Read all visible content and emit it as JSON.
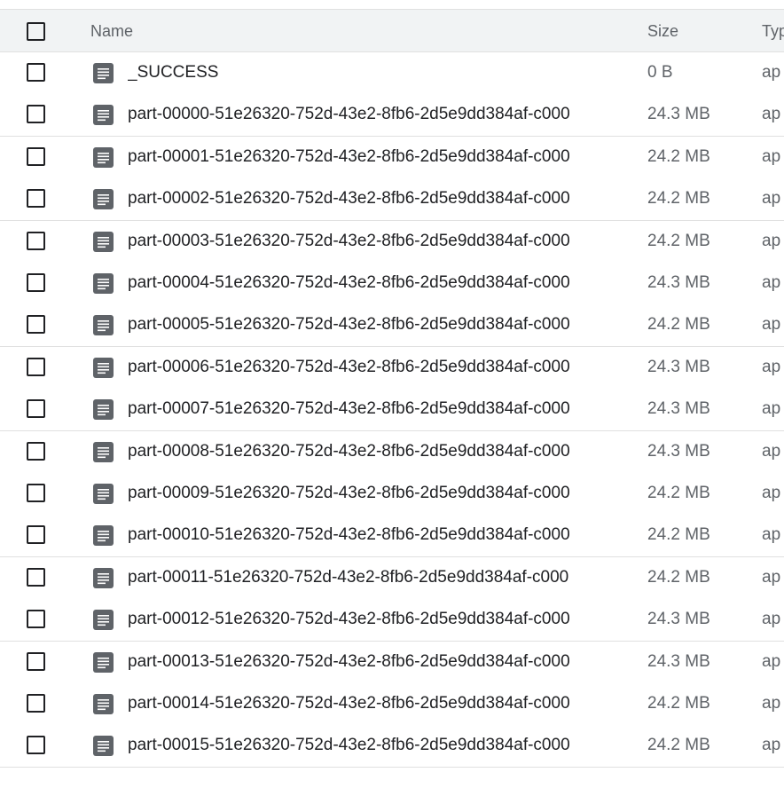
{
  "table": {
    "headers": {
      "name": "Name",
      "size": "Size",
      "type": "Typ"
    },
    "rows": [
      {
        "name": "_SUCCESS",
        "size": "0 B",
        "type": "ap"
      },
      {
        "name": "part-00000-51e26320-752d-43e2-8fb6-2d5e9dd384af-c000",
        "size": "24.3 MB",
        "type": "ap"
      },
      {
        "name": "part-00001-51e26320-752d-43e2-8fb6-2d5e9dd384af-c000",
        "size": "24.2 MB",
        "type": "ap"
      },
      {
        "name": "part-00002-51e26320-752d-43e2-8fb6-2d5e9dd384af-c000",
        "size": "24.2 MB",
        "type": "ap"
      },
      {
        "name": "part-00003-51e26320-752d-43e2-8fb6-2d5e9dd384af-c000",
        "size": "24.2 MB",
        "type": "ap"
      },
      {
        "name": "part-00004-51e26320-752d-43e2-8fb6-2d5e9dd384af-c000",
        "size": "24.3 MB",
        "type": "ap"
      },
      {
        "name": "part-00005-51e26320-752d-43e2-8fb6-2d5e9dd384af-c000",
        "size": "24.2 MB",
        "type": "ap"
      },
      {
        "name": "part-00006-51e26320-752d-43e2-8fb6-2d5e9dd384af-c000",
        "size": "24.3 MB",
        "type": "ap"
      },
      {
        "name": "part-00007-51e26320-752d-43e2-8fb6-2d5e9dd384af-c000",
        "size": "24.3 MB",
        "type": "ap"
      },
      {
        "name": "part-00008-51e26320-752d-43e2-8fb6-2d5e9dd384af-c000",
        "size": "24.3 MB",
        "type": "ap"
      },
      {
        "name": "part-00009-51e26320-752d-43e2-8fb6-2d5e9dd384af-c000",
        "size": "24.2 MB",
        "type": "ap"
      },
      {
        "name": "part-00010-51e26320-752d-43e2-8fb6-2d5e9dd384af-c000",
        "size": "24.2 MB",
        "type": "ap"
      },
      {
        "name": "part-00011-51e26320-752d-43e2-8fb6-2d5e9dd384af-c000",
        "size": "24.2 MB",
        "type": "ap"
      },
      {
        "name": "part-00012-51e26320-752d-43e2-8fb6-2d5e9dd384af-c000",
        "size": "24.3 MB",
        "type": "ap"
      },
      {
        "name": "part-00013-51e26320-752d-43e2-8fb6-2d5e9dd384af-c000",
        "size": "24.3 MB",
        "type": "ap"
      },
      {
        "name": "part-00014-51e26320-752d-43e2-8fb6-2d5e9dd384af-c000",
        "size": "24.2 MB",
        "type": "ap"
      },
      {
        "name": "part-00015-51e26320-752d-43e2-8fb6-2d5e9dd384af-c000",
        "size": "24.2 MB",
        "type": "ap"
      }
    ],
    "row_icon": "document-icon",
    "colors": {
      "icon": "#5f6368",
      "header_bg": "#f1f3f4",
      "border": "#e0e0e0"
    }
  }
}
